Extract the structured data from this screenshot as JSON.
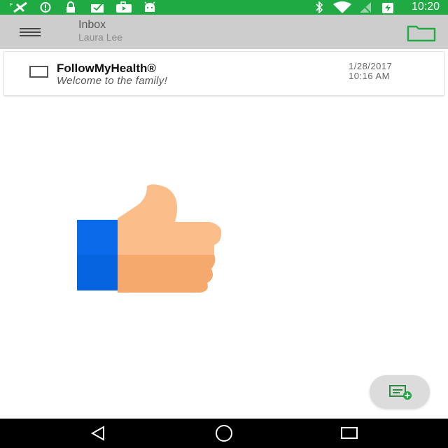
{
  "status_bar": {
    "time": "10:20",
    "icons": [
      "signal-off-icon",
      "alert-circle-icon",
      "lock-icon",
      "mail-check-icon",
      "youtube-icon",
      "android-icon",
      "bluetooth-icon",
      "wifi-icon",
      "no-signal-icon",
      "battery-charging-icon"
    ],
    "background": "#1faa44"
  },
  "app_bar": {
    "title": "Inbox",
    "subtitle": "Laura Lee",
    "menu_icon": "hamburger-menu-icon",
    "folder_icon": "folder-icon",
    "background": "#cdcdcd",
    "accent": "#1faa44"
  },
  "messages": [
    {
      "sender": "FollowMyHealth®",
      "subject": "Welcome to the family!",
      "date": "1/28/2017",
      "time": "10:16 AM"
    }
  ],
  "illustration": {
    "icon": "thumbs-up-icon",
    "sleeve_color": "#0a6bea",
    "hand_color": "#fbbe8a",
    "hand_shadow_color": "#f5a96c"
  },
  "fab": {
    "icon": "compose-message-icon"
  },
  "nav_bar": {
    "icons": [
      "back-icon",
      "home-icon",
      "recents-icon"
    ]
  }
}
